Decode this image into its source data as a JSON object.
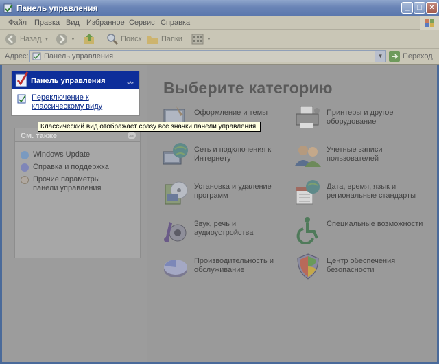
{
  "window": {
    "title": "Панель управления"
  },
  "menu": [
    "Файл",
    "Правка",
    "Вид",
    "Избранное",
    "Сервис",
    "Справка"
  ],
  "toolbar": {
    "back": "Назад",
    "search": "Поиск",
    "folders": "Папки"
  },
  "address": {
    "label": "Адрес:",
    "value": "Панель управления",
    "go": "Переход"
  },
  "left": {
    "panel_title": "Панель управления",
    "switch_link": "Переключение к классическому виду",
    "tooltip": "Классический вид отображает сразу все значки панели управления.",
    "see_also_title": "См. также",
    "see_also": [
      "Windows Update",
      "Справка и поддержка",
      "Прочие параметры панели управления"
    ]
  },
  "main": {
    "heading": "Выберите категорию",
    "categories": [
      "Оформление и темы",
      "Принтеры и другое оборудование",
      "Сеть и подключения к Интернету",
      "Учетные записи пользователей",
      "Установка и удаление программ",
      "Дата, время, язык и региональные стандарты",
      "Звук, речь и аудиоустройства",
      "Специальные возможности",
      "Производительность и обслуживание",
      "Центр обеспечения безопасности"
    ]
  }
}
